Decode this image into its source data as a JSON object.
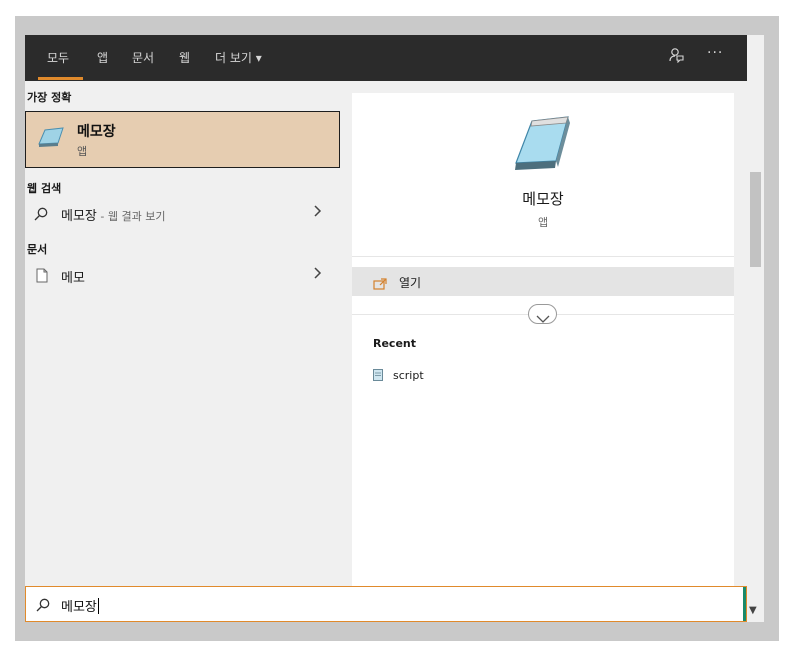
{
  "topbar": {
    "tabs": [
      {
        "label": "모두"
      },
      {
        "label": "앱"
      },
      {
        "label": "문서"
      },
      {
        "label": "웹"
      },
      {
        "label": "더 보기 ▾"
      }
    ],
    "icons": [
      "feedback-icon",
      "more-icon"
    ],
    "more_glyph": "···"
  },
  "results": {
    "best_match_header": "가장 정확",
    "best_match": {
      "title": "메모장",
      "subtitle": "앱"
    },
    "web_header": "웹 검색",
    "web_item": {
      "query": "메모장",
      "suffix": " - 웹 결과 보기"
    },
    "docs_header": "문서",
    "doc_item": {
      "label": "메모"
    }
  },
  "preview": {
    "title": "메모장",
    "subtitle": "앱",
    "action_open": "열기",
    "recent_header": "Recent",
    "recent_items": [
      {
        "label": "script"
      }
    ]
  },
  "search": {
    "value": "메모장"
  },
  "colors": {
    "accent": "#e08a2c",
    "selected": "#e6cdb1",
    "topbar": "#2b2b2b"
  }
}
